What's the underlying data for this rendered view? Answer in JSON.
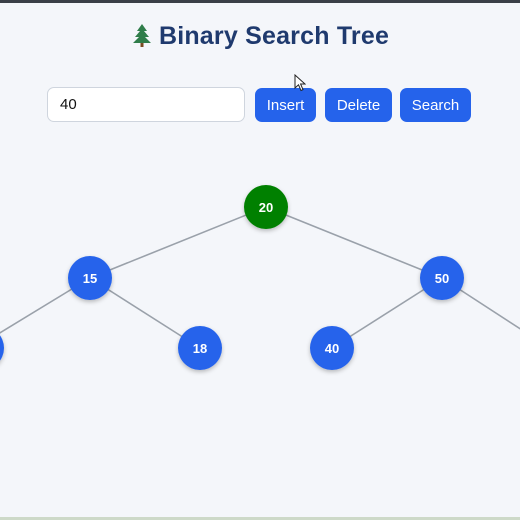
{
  "app": {
    "title": "Binary Search Tree",
    "title_icon": "tree-icon"
  },
  "controls": {
    "input_value": "40",
    "insert_label": "Insert",
    "delete_label": "Delete",
    "search_label": "Search"
  },
  "colors": {
    "accent": "#2563eb",
    "highlight": "#008000",
    "title": "#1f3a6e",
    "edge": "#9aa1aa",
    "background": "#f4f6fa"
  },
  "tree": {
    "nodes": [
      {
        "id": "n20",
        "value": "20",
        "state": "highlighted"
      },
      {
        "id": "n15",
        "value": "15",
        "state": "normal"
      },
      {
        "id": "n50",
        "value": "50",
        "state": "normal"
      },
      {
        "id": "n18",
        "value": "18",
        "state": "normal"
      },
      {
        "id": "n40",
        "value": "40",
        "state": "normal"
      }
    ],
    "edges": [
      [
        "n20",
        "n15"
      ],
      [
        "n20",
        "n50"
      ],
      [
        "n15",
        "n18"
      ],
      [
        "n50",
        "n40"
      ]
    ]
  }
}
